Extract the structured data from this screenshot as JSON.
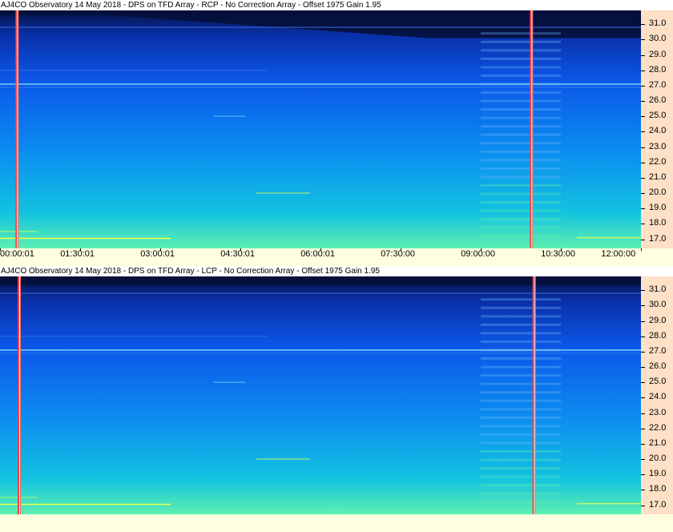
{
  "panels": [
    {
      "title": "AJ4CO Observatory 14 May 2018 - DPS on TFD Array  - RCP  -  No Correction Array  -  Offset 1975  Gain 1.95"
    },
    {
      "title": "AJ4CO Observatory 14 May 2018 - DPS on TFD Array  - LCP  -  No Correction Array  -  Offset 1975  Gain 1.95"
    }
  ],
  "chart_data": [
    {
      "type": "heatmap",
      "title": "AJ4CO Observatory 14 May 2018 - DPS on TFD Array  - RCP  -  No Correction Array  -  Offset 1975  Gain 1.95",
      "x_tick_labels": [
        "00:00:01",
        "01:30:01",
        "03:00:01",
        "04:30:01",
        "06:00:01",
        "07:30:00",
        "09:00:00",
        "10:30:00",
        "12:00:00"
      ],
      "y_tick_labels": [
        "31.0",
        "30.0",
        "29.0",
        "28.0",
        "27.0",
        "26.0",
        "25.0",
        "24.0",
        "23.0",
        "22.0",
        "21.0",
        "20.0",
        "19.0",
        "18.0",
        "17.0"
      ],
      "ylim": [
        16.4,
        31.9
      ],
      "xlim_hours": [
        0,
        12
      ],
      "vertical_markers_hours": [
        0.32,
        9.95
      ],
      "colormap": [
        "#05123f",
        "#0a2fa8",
        "#0b58e8",
        "#0b8ef0",
        "#12c3e0",
        "#5ef0b0",
        "#ffff40"
      ]
    },
    {
      "type": "heatmap",
      "title": "AJ4CO Observatory 14 May 2018 - DPS on TFD Array  - LCP  -  No Correction Array  -  Offset 1975  Gain 1.95",
      "y_tick_labels": [
        "31.0",
        "30.0",
        "29.0",
        "28.0",
        "27.0",
        "26.0",
        "25.0",
        "24.0",
        "23.0",
        "22.0",
        "21.0",
        "20.0",
        "19.0",
        "18.0",
        "17.0"
      ],
      "ylim": [
        16.4,
        31.9
      ],
      "xlim_hours": [
        0,
        12
      ],
      "vertical_markers_hours": [
        0.36,
        10.0
      ],
      "colormap": [
        "#05123f",
        "#0a2fa8",
        "#0b58e8",
        "#0b8ef0",
        "#12c3e0",
        "#5ef0b0",
        "#ffff40"
      ]
    }
  ]
}
